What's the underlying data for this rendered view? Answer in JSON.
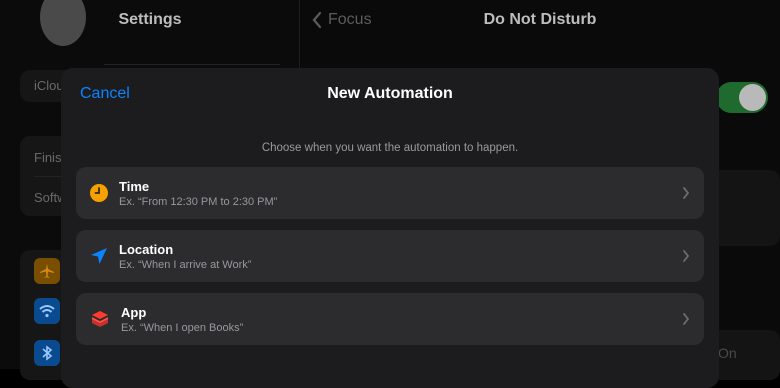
{
  "background": {
    "left_title": "Settings",
    "back_label": "Focus",
    "right_title": "Do Not Disturb",
    "partial_labels": [
      "iClou",
      "Finis",
      "Softw"
    ],
    "on_label": "On",
    "colors": {
      "toggle": "#1f6a2e",
      "airplane": "#f7a100",
      "wifi": "#0a84ff",
      "bluetooth": "#0a84ff"
    }
  },
  "sheet": {
    "cancel_label": "Cancel",
    "title": "New Automation",
    "hint": "Choose when you want the automation to happen.",
    "options": [
      {
        "icon": "clock-icon",
        "title": "Time",
        "subtitle": "Ex. “From 12:30 PM to 2:30 PM”",
        "color": "#f7a100"
      },
      {
        "icon": "location-arrow-icon",
        "title": "Location",
        "subtitle": "Ex. “When I arrive at Work”",
        "color": "#0a84ff"
      },
      {
        "icon": "layers-icon",
        "title": "App",
        "subtitle": "Ex. “When I open Books”",
        "color": "#ff3b30"
      }
    ]
  }
}
